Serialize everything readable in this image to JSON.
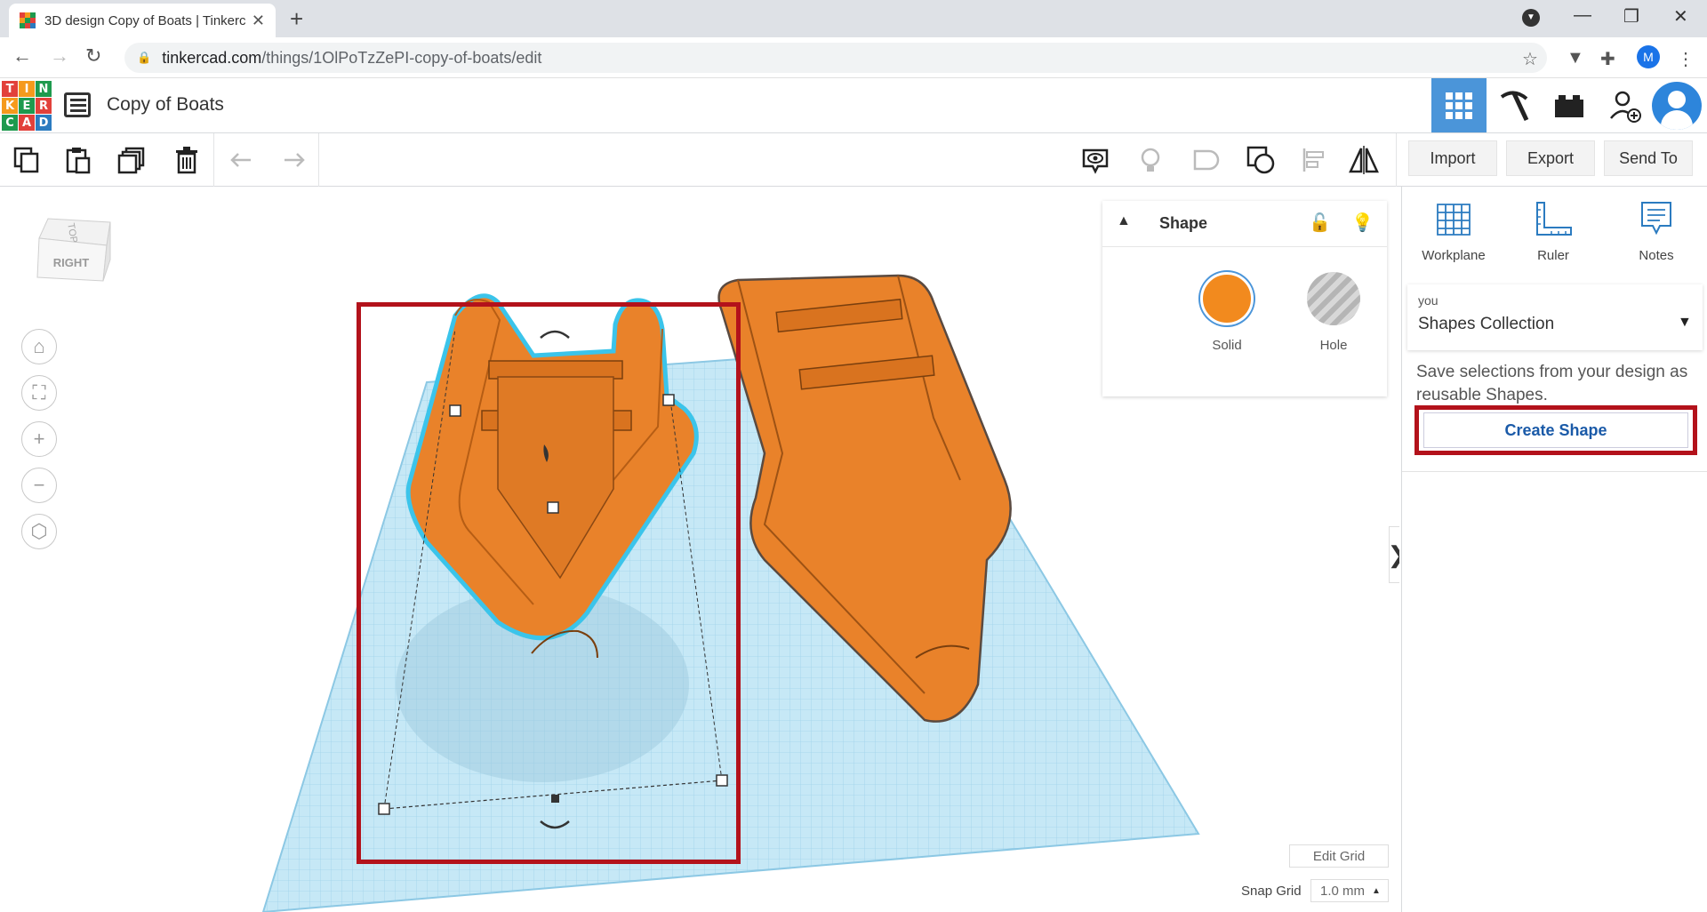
{
  "browser": {
    "tab_title": "3D design Copy of Boats | Tinkercad",
    "url_host": "tinkercad.com",
    "url_path": "/things/1OlPoTzZePI-copy-of-boats/edit",
    "profile_initial": "M"
  },
  "header": {
    "logo_letters": [
      "T",
      "I",
      "N",
      "K",
      "E",
      "R",
      "C",
      "A",
      "D"
    ],
    "logo_colors": [
      "#e2413b",
      "#f59a1d",
      "#1e9a4e",
      "#f59a1d",
      "#1e9a4e",
      "#e2413b",
      "#1e9a4e",
      "#e2413b",
      "#2b7bc0"
    ],
    "design_title": "Copy of Boats",
    "icons": [
      "grid-view-icon",
      "pickaxe-icon",
      "bricks-icon",
      "add-user-icon",
      "avatar-icon"
    ]
  },
  "toolbar": {
    "left_tools": [
      "copy-icon",
      "paste-icon",
      "duplicate-icon",
      "delete-icon",
      "undo-icon",
      "redo-icon"
    ],
    "right_tools": [
      "show-all-icon",
      "bulb-icon",
      "group-icon",
      "ungroup-icon",
      "align-icon",
      "mirror-icon"
    ],
    "import_label": "Import",
    "export_label": "Export",
    "send_to_label": "Send To"
  },
  "workspace": {
    "viewcube_top": "TOP",
    "viewcube_right": "RIGHT",
    "workplane_label": "Workplane",
    "edit_grid_label": "Edit Grid",
    "snap_grid_label": "Snap Grid",
    "snap_grid_value": "1.0 mm"
  },
  "shape_panel": {
    "title": "Shape",
    "solid_label": "Solid",
    "hole_label": "Hole",
    "solid_color": "#f28a1e"
  },
  "right_panel": {
    "workplane_label": "Workplane",
    "ruler_label": "Ruler",
    "notes_label": "Notes",
    "collection_owner": "you",
    "collection_name": "Shapes Collection",
    "description": "Save selections from your design as reusable Shapes.",
    "create_shape_label": "Create Shape"
  },
  "colors": {
    "accent_blue": "#4b95d9",
    "highlight_red": "#b3121b",
    "boat_orange": "#e9822a",
    "grid_blue": "#bfe3f2"
  }
}
